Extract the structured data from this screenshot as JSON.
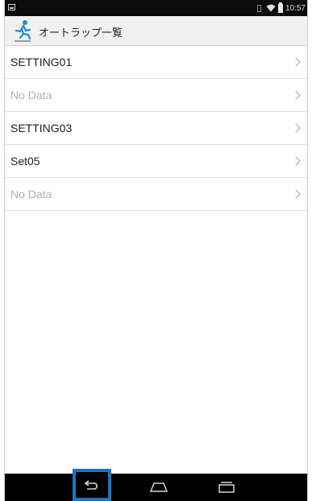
{
  "status_bar": {
    "time": "10:57"
  },
  "header": {
    "title": "オートラップ一覧",
    "app_icon": "runner-icon"
  },
  "list": {
    "items": [
      {
        "label": "SETTING01",
        "empty": false
      },
      {
        "label": "No Data",
        "empty": true
      },
      {
        "label": "SETTING03",
        "empty": false
      },
      {
        "label": "Set05",
        "empty": false
      },
      {
        "label": "No Data",
        "empty": true
      }
    ]
  },
  "nav": {
    "back": "back-icon",
    "home": "home-icon",
    "recent": "recent-apps-icon"
  },
  "colors": {
    "highlight_border": "#1c74c8",
    "runner_icon": "#1a8ad6"
  }
}
